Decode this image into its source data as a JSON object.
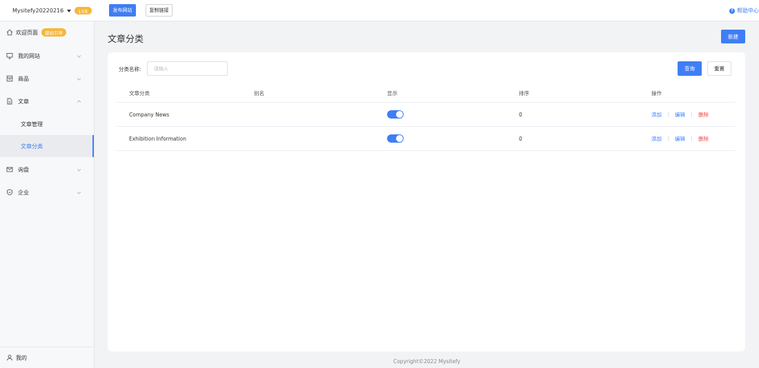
{
  "topbar": {
    "site_name": "Mysitefy20220216",
    "days_badge": "13天",
    "publish_label": "发布网站",
    "copy_link_label": "复制链接",
    "help_label": "帮助中心"
  },
  "sidebar": {
    "items": [
      {
        "label": "欢迎页面",
        "badge": "建站引导",
        "icon": "home-icon"
      },
      {
        "label": "我的网站",
        "icon": "monitor-icon",
        "expanded": false
      },
      {
        "label": "商品",
        "icon": "product-icon",
        "expanded": false
      },
      {
        "label": "文章",
        "icon": "document-icon",
        "expanded": true
      },
      {
        "label": "询盘",
        "icon": "mail-icon",
        "expanded": false
      },
      {
        "label": "企业",
        "icon": "shield-icon",
        "expanded": false
      }
    ],
    "sub_items": [
      {
        "label": "文章管理",
        "active": false
      },
      {
        "label": "文章分类",
        "active": true
      }
    ],
    "bottom_label": "我的"
  },
  "main": {
    "title": "文章分类",
    "new_label": "新建",
    "filter": {
      "label": "分类名称:",
      "placeholder": "请输入",
      "query_label": "查询",
      "reset_label": "重置"
    },
    "table": {
      "columns": [
        "文章分类",
        "别名",
        "显示",
        "排序",
        "操作"
      ],
      "rows": [
        {
          "category": "Company News",
          "alias": "",
          "shown": true,
          "order": "0",
          "actions": [
            "添加",
            "编辑",
            "删除"
          ]
        },
        {
          "category": "Exhibition Information",
          "alias": "",
          "shown": true,
          "order": "0",
          "actions": [
            "添加",
            "编辑",
            "删除"
          ]
        }
      ]
    }
  },
  "footer": {
    "copyright": "Copyright©2022 Mysitefy"
  },
  "colors": {
    "accent": "#3f7ef5",
    "badge": "#f5b73b",
    "danger": "#f04848"
  }
}
